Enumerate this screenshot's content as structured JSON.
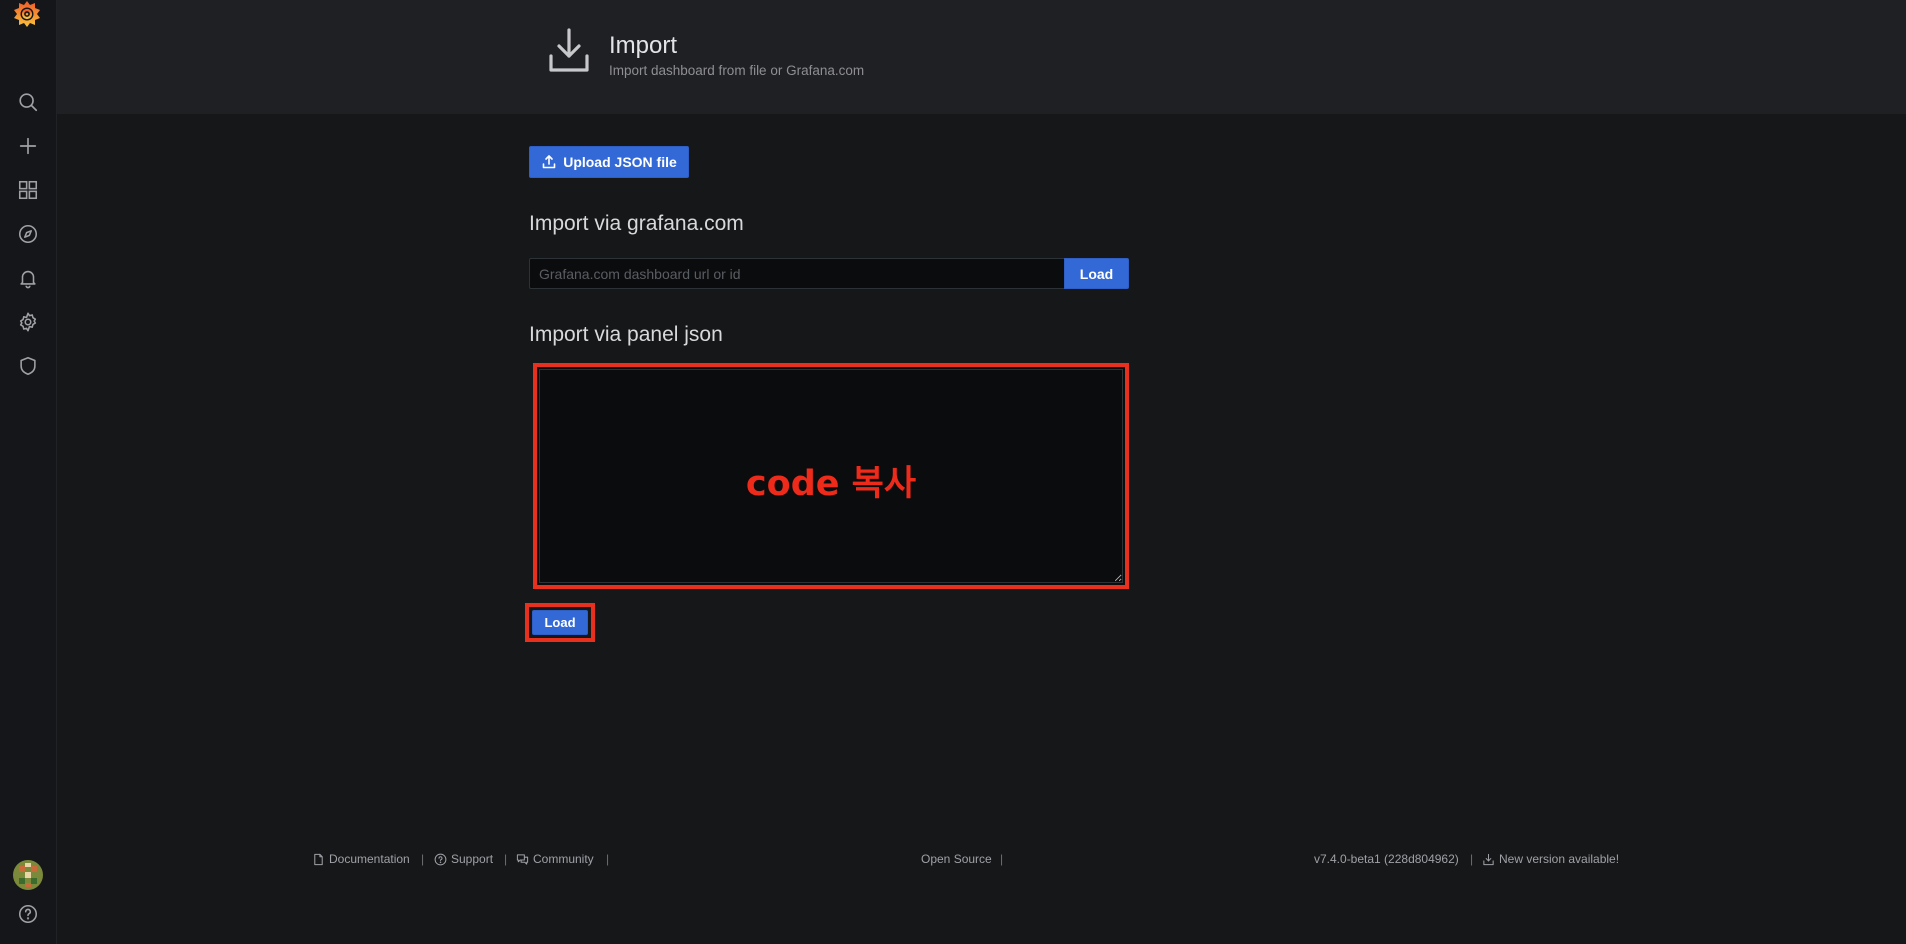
{
  "header": {
    "title": "Import",
    "subtitle": "Import dashboard from file or Grafana.com"
  },
  "upload": {
    "label": "Upload JSON file"
  },
  "grafana_com": {
    "title": "Import via grafana.com",
    "placeholder": "Grafana.com dashboard url or id",
    "load_label": "Load"
  },
  "panel_json": {
    "title": "Import via panel json",
    "annotation": "code 복사",
    "load_label": "Load"
  },
  "sidebar": {
    "icons": [
      "grafana-logo-icon",
      "search-icon",
      "plus-icon",
      "dashboards-icon",
      "explore-icon",
      "bell-icon",
      "gear-icon",
      "shield-icon",
      "avatar",
      "help-icon"
    ]
  },
  "footer": {
    "documentation": "Documentation",
    "support": "Support",
    "community": "Community",
    "open_source": "Open Source",
    "version": "v7.4.0-beta1 (228d804962)",
    "new_version": "New version available!",
    "separator": "|"
  },
  "colors": {
    "accent": "#3369d6",
    "annotation_red": "#e8301e",
    "background": "#161719",
    "header_bg": "#1f2024"
  }
}
